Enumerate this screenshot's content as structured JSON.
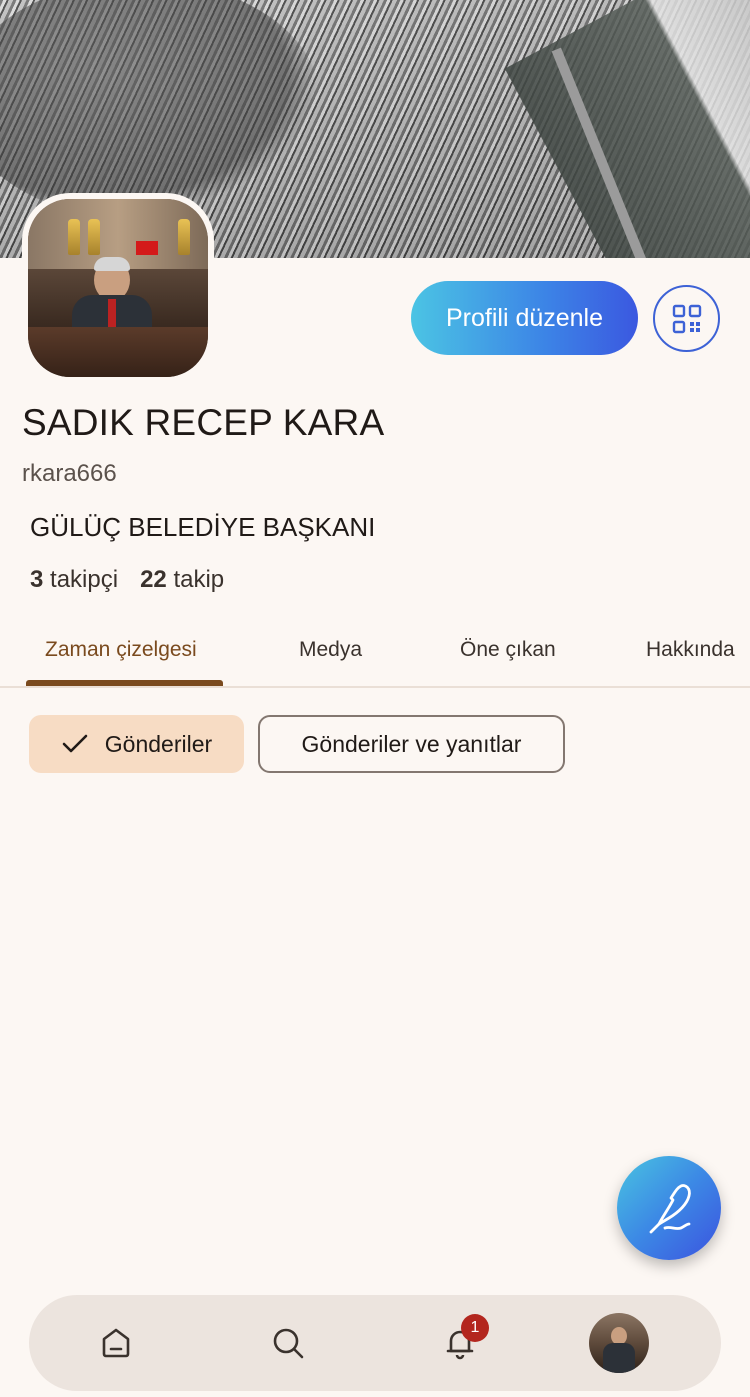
{
  "profile": {
    "display_name": "SADIK RECEP KARA",
    "handle": "rkara666",
    "bio": "GÜLÜÇ BELEDİYE BAŞKANI",
    "followers_count": "3",
    "followers_label": "takipçi",
    "following_count": "22",
    "following_label": "takip"
  },
  "actions": {
    "edit_profile_label": "Profili düzenle",
    "qr_icon": "qr-code-icon"
  },
  "tabs": [
    {
      "label": "Zaman çizelgesi",
      "active": true
    },
    {
      "label": "Medya",
      "active": false
    },
    {
      "label": "Öne çıkan",
      "active": false
    },
    {
      "label": "Hakkında",
      "active": false
    }
  ],
  "filters": [
    {
      "label": "Gönderiler",
      "selected": true,
      "icon": "check-icon"
    },
    {
      "label": "Gönderiler ve yanıtlar",
      "selected": false
    }
  ],
  "fab": {
    "icon": "compose-feather-icon"
  },
  "bottom_nav": {
    "items": [
      {
        "icon": "home-icon"
      },
      {
        "icon": "search-icon"
      },
      {
        "icon": "bell-icon",
        "badge": "1"
      },
      {
        "icon": "profile-avatar"
      }
    ]
  },
  "colors": {
    "background": "#fcf7f3",
    "accent_brown": "#7a4a1e",
    "chip_selected": "#f7dcc4",
    "gradient_start": "#4bc4e4",
    "gradient_end": "#3b58e0",
    "badge_red": "#b3261e"
  }
}
